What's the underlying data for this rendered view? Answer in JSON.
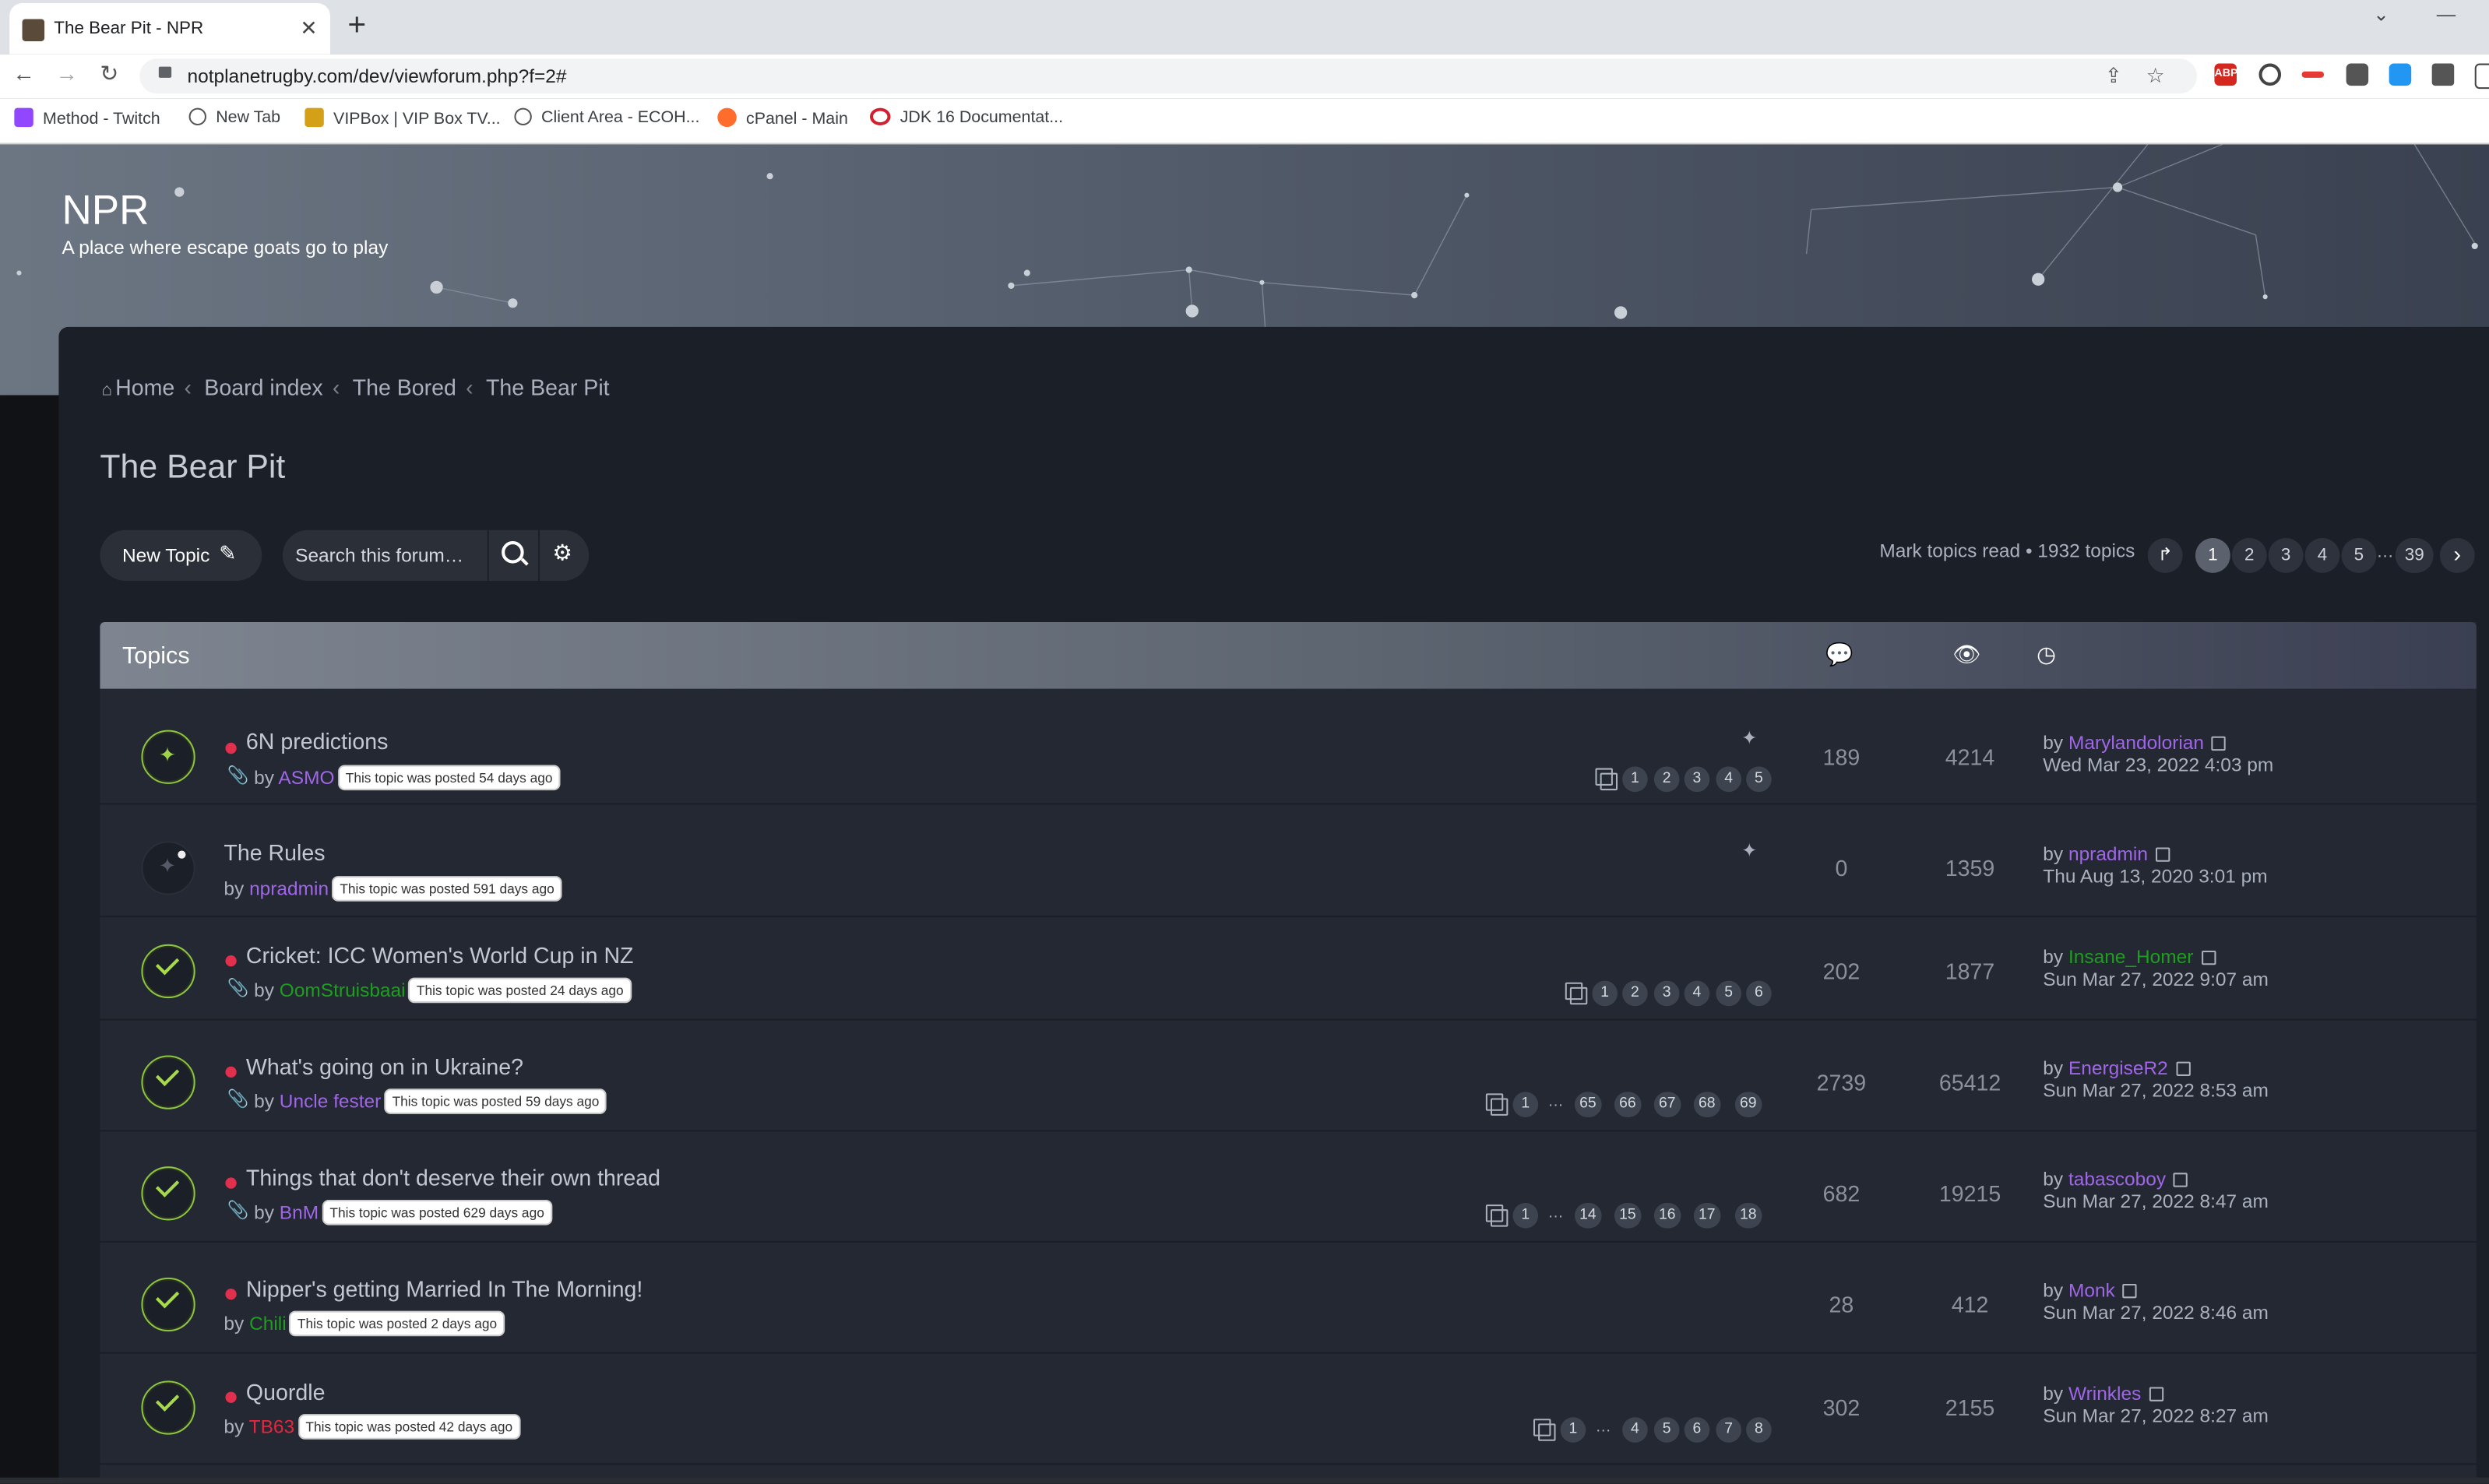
{
  "browser": {
    "tab_title": "The Bear Pit - NPR",
    "url": "notplanetrugby.com/dev/viewforum.php?f=2#",
    "bookmarks": [
      "Method - Twitch",
      "New Tab",
      "VIPBox | VIP Box TV...",
      "Client Area - ECOH...",
      "cPanel - Main",
      "JDK 16 Documentat..."
    ],
    "extensions": [
      "ABP"
    ]
  },
  "site": {
    "title": "NPR",
    "description": "A place where escape goats go to play"
  },
  "breadcrumbs": [
    "Home",
    "Board index",
    "The Bored",
    "The Bear Pit"
  ],
  "forum_title": "The Bear Pit",
  "actions": {
    "new_topic": "New Topic",
    "search_placeholder": "Search this forum…",
    "mark_read": "Mark topics read • 1932 topics"
  },
  "pagination": {
    "pages": [
      "1",
      "2",
      "3",
      "4",
      "5"
    ],
    "ellipsis": "…",
    "last": "39",
    "current": "1"
  },
  "topics_header": "Topics",
  "colors": {
    "accent_purple": "#a066e8",
    "accent_green": "#1f9d20",
    "accent_red": "#e2273f",
    "unread_dot": "#e0304e",
    "status_check": "#a6d94c"
  },
  "topics": [
    {
      "title": "6N predictions",
      "by": "by",
      "author": "ASMO",
      "posted": "This topic was posted 54 days ago",
      "pages": [
        "1",
        "2",
        "3",
        "4",
        "5"
      ],
      "replies": "189",
      "views": "4214",
      "last_by": "by",
      "last_author": "Marylandolorian",
      "last_date": "Wed Mar 23, 2022 4:03 pm"
    },
    {
      "title": "The Rules",
      "by": "by",
      "author": "npradmin",
      "posted": "This topic was posted 591 days ago",
      "replies": "0",
      "views": "1359",
      "last_by": "by",
      "last_author": "npradmin",
      "last_date": "Thu Aug 13, 2020 3:01 pm"
    },
    {
      "title": "Cricket: ICC Women's World Cup in NZ",
      "by": "by",
      "author": "OomStruisbaai",
      "posted": "This topic was posted 24 days ago",
      "pages": [
        "1",
        "2",
        "3",
        "4",
        "5",
        "6"
      ],
      "replies": "202",
      "views": "1877",
      "last_by": "by",
      "last_author": "Insane_Homer",
      "last_date": "Sun Mar 27, 2022 9:07 am"
    },
    {
      "title": "What's going on in Ukraine?",
      "by": "by",
      "author": "Uncle fester",
      "posted": "This topic was posted 59 days ago",
      "pages": [
        "1",
        "65",
        "66",
        "67",
        "68",
        "69"
      ],
      "replies": "2739",
      "views": "65412",
      "last_by": "by",
      "last_author": "EnergiseR2",
      "last_date": "Sun Mar 27, 2022 8:53 am"
    },
    {
      "title": "Things that don't deserve their own thread",
      "by": "by",
      "author": "BnM",
      "posted": "This topic was posted 629 days ago",
      "pages": [
        "1",
        "14",
        "15",
        "16",
        "17",
        "18"
      ],
      "replies": "682",
      "views": "19215",
      "last_by": "by",
      "last_author": "tabascoboy",
      "last_date": "Sun Mar 27, 2022 8:47 am"
    },
    {
      "title": "Nipper's getting Married In The Morning!",
      "by": "by",
      "author": "Chili",
      "posted": "This topic was posted 2 days ago",
      "replies": "28",
      "views": "412",
      "last_by": "by",
      "last_author": "Monk",
      "last_date": "Sun Mar 27, 2022 8:46 am"
    },
    {
      "title": "Quordle",
      "by": "by",
      "author": "TB63",
      "posted": "This topic was posted 42 days ago",
      "pages": [
        "1",
        "4",
        "5",
        "6",
        "7",
        "8"
      ],
      "replies": "302",
      "views": "2155",
      "last_by": "by",
      "last_author": "Wrinkles",
      "last_date": "Sun Mar 27, 2022 8:27 am"
    }
  ]
}
